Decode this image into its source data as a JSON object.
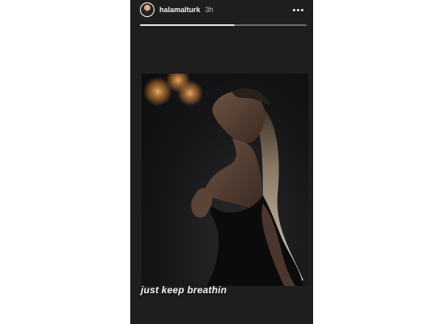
{
  "story": {
    "username": "halamalturk",
    "time": "3h",
    "progress": 0.57,
    "caption": "just keep breathin",
    "more_icon": "more-horizontal-icon",
    "background_color": "#1e1e1e"
  }
}
